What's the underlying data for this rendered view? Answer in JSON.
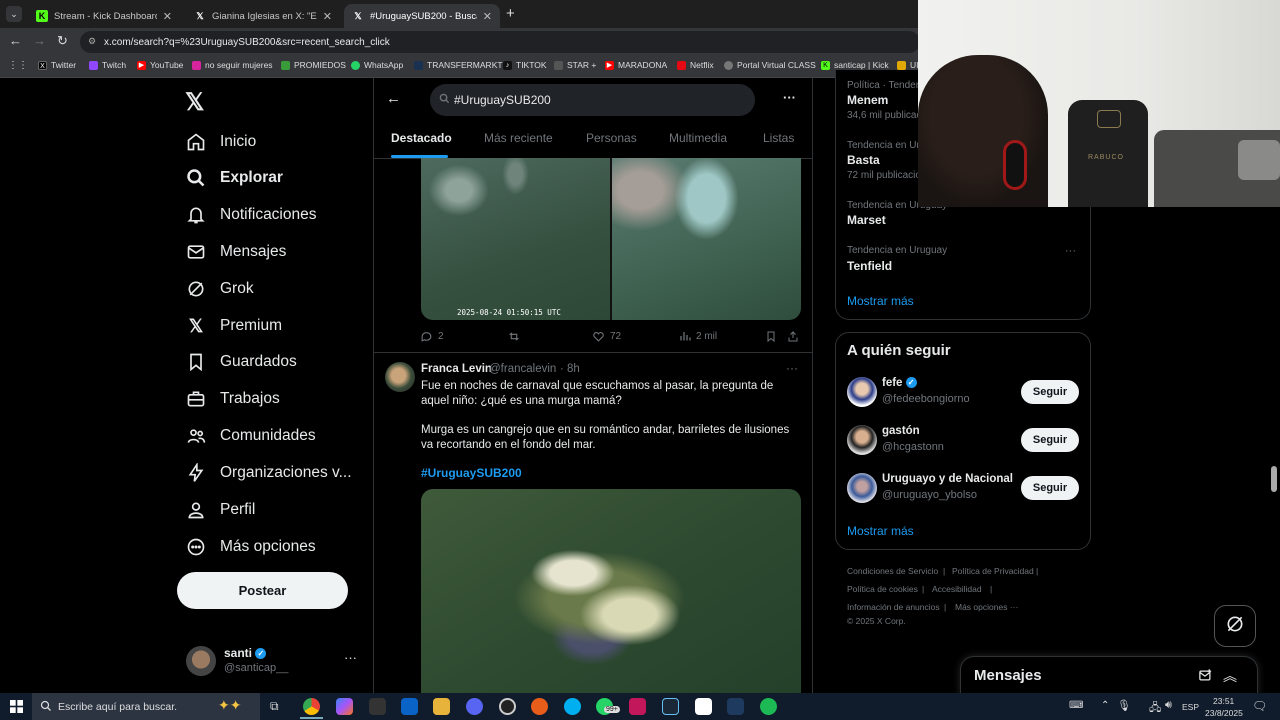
{
  "browser": {
    "tabs": [
      {
        "title": "Stream - Kick Dashboard",
        "active": false
      },
      {
        "title": "Gianina Iglesias en X: \"En el top",
        "active": false
      },
      {
        "title": "#UruguaySUB200 - Buscar / X",
        "active": true
      }
    ],
    "url": "x.com/search?q=%23UruguaySUB200&src=recent_search_click",
    "bookmarks": [
      "Twitter",
      "Twitch",
      "YouTube",
      "no seguir mujeres",
      "PROMIEDOS",
      "WhatsApp",
      "TRANSFERMARKT",
      "TIKTOK",
      "STAR +",
      "MARADONA",
      "Netflix",
      "Portal Virtual CLASS",
      "santicap | Kick",
      "UI"
    ]
  },
  "nav": {
    "items": [
      "Inicio",
      "Explorar",
      "Notificaciones",
      "Mensajes",
      "Grok",
      "Premium",
      "Guardados",
      "Trabajos",
      "Comunidades",
      "Organizaciones v...",
      "Perfil",
      "Más opciones"
    ],
    "post_label": "Postear",
    "account_name": "santi",
    "account_handle": "@santicap__"
  },
  "search": {
    "query": "#UruguaySUB200",
    "tabs": [
      "Destacado",
      "Más reciente",
      "Personas",
      "Multimedia",
      "Listas"
    ]
  },
  "tweet1": {
    "timestamp_overlay": "2025-08-24 01:50:15 UTC",
    "replies": "2",
    "likes": "72",
    "views": "2 mil"
  },
  "tweet2": {
    "name": "Franca Levin",
    "handle": "@francalevin",
    "time": "· 8h",
    "text1": "Fue en noches de carnaval que escuchamos al pasar, la pregunta de aquel niño: ¿qué es una murga mamá?",
    "text2": "Murga es un cangrejo que en su romántico andar, barriletes de ilusiones va recortando en el fondo del mar.",
    "hashtag": "#UruguaySUB200"
  },
  "trends": [
    {
      "category": "Política · Tendencia",
      "name": "Menem",
      "count": "34,6 mil publicaciones"
    },
    {
      "category": "Tendencia en Uruguay",
      "name": "Basta",
      "count": "72 mil publicaciones"
    },
    {
      "category": "Tendencia en Uruguay",
      "name": "Marset",
      "count": ""
    },
    {
      "category": "Tendencia en Uruguay",
      "name": "Tenfield",
      "count": ""
    }
  ],
  "trends_more": "Mostrar más",
  "who_to_follow": {
    "title": "A quién seguir",
    "people": [
      {
        "name": "fefe",
        "handle": "@fedeebongiorno",
        "verified": true
      },
      {
        "name": "gastón",
        "handle": "@hcgastonn",
        "verified": false
      },
      {
        "name": "Uruguayo y de Nacional",
        "handle": "@uruguayo_ybolso",
        "verified": false
      }
    ],
    "follow_label": "Seguir",
    "more": "Mostrar más"
  },
  "footer": {
    "links": [
      "Condiciones de Servicio",
      "Política de Privacidad",
      "Política de cookies",
      "Accesibilidad",
      "Información de anuncios",
      "Más opciones ···"
    ],
    "copyright": "© 2025 X Corp."
  },
  "messages_drawer": {
    "title": "Mensajes"
  },
  "taskbar": {
    "search_placeholder": "Escribe aquí para buscar.",
    "lang": "ESP",
    "time": "23:51",
    "date": "23/8/2025",
    "badge": "99+"
  },
  "colors": {
    "accent": "#1d9bf0",
    "background": "#000000",
    "border": "#2f3336",
    "muted": "#71767b"
  }
}
